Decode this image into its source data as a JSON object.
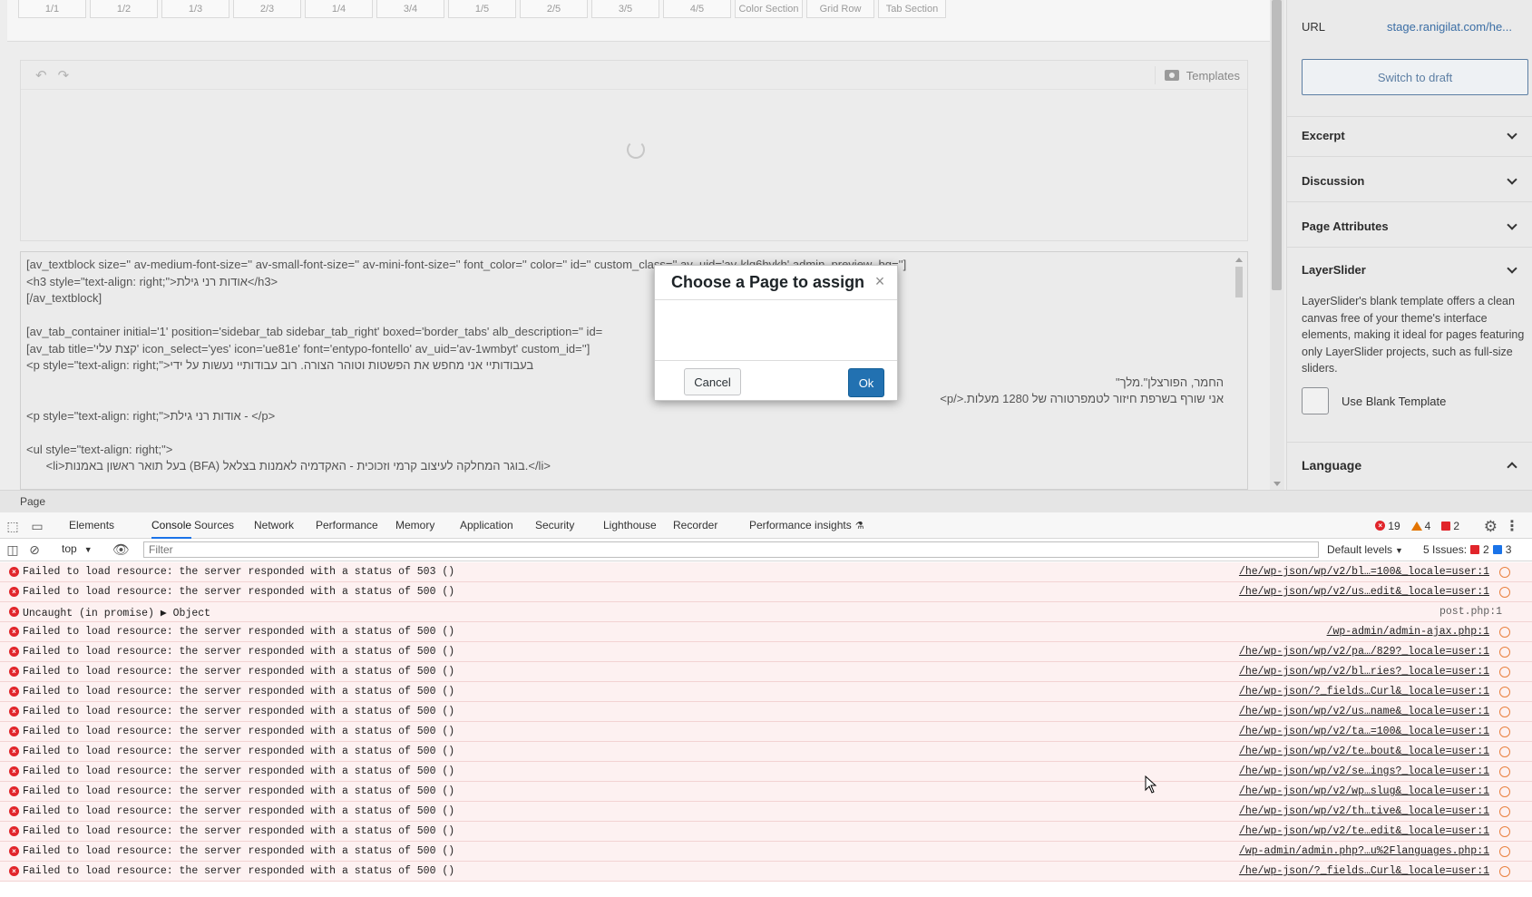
{
  "layout_bar": [
    "1/1",
    "1/2",
    "1/3",
    "2/3",
    "1/4",
    "3/4",
    "1/5",
    "2/5",
    "3/5",
    "4/5",
    "Color Section",
    "Grid Row",
    "Tab Section"
  ],
  "builder": {
    "templates_label": "Templates"
  },
  "code_lines": [
    "[av_textblock size='' av-medium-font-size='' av-small-font-size='' av-mini-font-size='' font_color='' color='' id='' custom_class='' av_uid='av-klq6hvkh' admin_preview_bg='']",
    "<h3 style=\"text-align: right;\">אודות רני גילת</h3>",
    "[/av_textblock]",
    "",
    "[av_tab_container initial='1' position='sidebar_tab sidebar_tab_right' boxed='border_tabs' alb_description='' id=",
    "[av_tab title='קצת עלי' icon_select='yes' icon='ue81e' font='entypo-fontello' av_uid='av-1wmbyt' custom_id='']",
    "<p style=\"text-align: right;\">בעבודותיי אני מחפש את הפשטות וטוהר הצורה. רוב עבודותיי נעשות על ידי",
    "החמר, הפורצלן\".מלך\"",
    "אני שורף בשרפת חיזור לטמפרטורה של 1280 מעלות.</p>",
    "<p style=\"text-align: right;\">אודות רני גילת - </p>",
    "",
    "<ul style=\"text-align: right;\">",
    "      <li>בעל תואר ראשון באמנות (BFA) בוגר המחלקה לעיצוב קרמי וזכוכית - האקדמיה לאמנות בצלאל.</li>"
  ],
  "sidebar": {
    "url_label": "URL",
    "url_value": "stage.ranigilat.com/he...",
    "switch_draft": "Switch to draft",
    "excerpt": "Excerpt",
    "discussion": "Discussion",
    "page_attributes": "Page Attributes",
    "layerslider": "LayerSlider",
    "layerslider_desc": "LayerSlider's blank template offers a clean canvas free of your theme's interface elements, making it ideal for pages featuring only LayerSlider projects, such as full-size sliders.",
    "use_blank": "Use Blank Template",
    "language": "Language"
  },
  "page_footer": "Page",
  "modal": {
    "title": "Choose a Page to assign",
    "close": "×",
    "cancel": "Cancel",
    "ok": "Ok"
  },
  "devtools": {
    "tabs": [
      "Elements",
      "Console",
      "Sources",
      "Network",
      "Performance",
      "Memory",
      "Application",
      "Security",
      "Lighthouse",
      "Recorder",
      "Performance insights"
    ],
    "active_tab": "Console",
    "error_count": "19",
    "warning_count": "4",
    "issue_flag_count": "2",
    "context": "top",
    "filter_placeholder": "Filter",
    "default_levels": "Default levels",
    "issues_label": "5 Issues:",
    "issues_errors": "2",
    "issues_info": "3",
    "colors": {
      "error": "#e1252b",
      "warning": "#e37400",
      "accent": "#1a73e8"
    }
  },
  "console": [
    {
      "msg": "Failed to load resource: the server responded with a status of 503 ()",
      "src": "/he/wp-json/wp/v2/bl…=100&_locale=user:1"
    },
    {
      "msg": "Failed to load resource: the server responded with a status of 500 ()",
      "src": "/he/wp-json/wp/v2/us…edit&_locale=user:1"
    },
    {
      "msg": "Uncaught (in promise) ▶ Object",
      "src": "post.php:1",
      "plain": true
    },
    {
      "msg": "Failed to load resource: the server responded with a status of 500 ()",
      "src": "/wp-admin/admin-ajax.php:1"
    },
    {
      "msg": "Failed to load resource: the server responded with a status of 500 ()",
      "src": "/he/wp-json/wp/v2/pa…/829?_locale=user:1"
    },
    {
      "msg": "Failed to load resource: the server responded with a status of 500 ()",
      "src": "/he/wp-json/wp/v2/bl…ries?_locale=user:1"
    },
    {
      "msg": "Failed to load resource: the server responded with a status of 500 ()",
      "src": "/he/wp-json/?_fields…Curl&_locale=user:1"
    },
    {
      "msg": "Failed to load resource: the server responded with a status of 500 ()",
      "src": "/he/wp-json/wp/v2/us…name&_locale=user:1"
    },
    {
      "msg": "Failed to load resource: the server responded with a status of 500 ()",
      "src": "/he/wp-json/wp/v2/ta…=100&_locale=user:1"
    },
    {
      "msg": "Failed to load resource: the server responded with a status of 500 ()",
      "src": "/he/wp-json/wp/v2/te…bout&_locale=user:1"
    },
    {
      "msg": "Failed to load resource: the server responded with a status of 500 ()",
      "src": "/he/wp-json/wp/v2/se…ings?_locale=user:1"
    },
    {
      "msg": "Failed to load resource: the server responded with a status of 500 ()",
      "src": "/he/wp-json/wp/v2/wp…slug&_locale=user:1"
    },
    {
      "msg": "Failed to load resource: the server responded with a status of 500 ()",
      "src": "/he/wp-json/wp/v2/th…tive&_locale=user:1"
    },
    {
      "msg": "Failed to load resource: the server responded with a status of 500 ()",
      "src": "/he/wp-json/wp/v2/te…edit&_locale=user:1"
    },
    {
      "msg": "Failed to load resource: the server responded with a status of 500 ()",
      "src": "/wp-admin/admin.php?…u%2Flanguages.php:1"
    },
    {
      "msg": "Failed to load resource: the server responded with a status of 500 ()",
      "src": "/he/wp-json/?_fields…Curl&_locale=user:1"
    }
  ]
}
